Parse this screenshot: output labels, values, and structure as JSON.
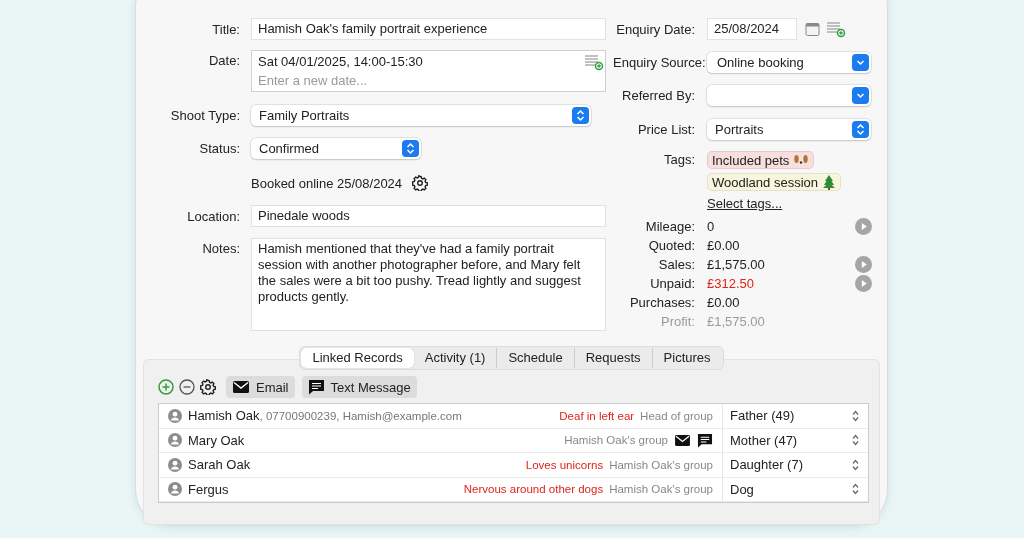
{
  "title": {
    "label": "Title:",
    "value": "Hamish Oak's family portrait experience"
  },
  "date": {
    "label": "Date:",
    "value": "Sat 04/01/2025, 14:00-15:30",
    "placeholder": "Enter a new date..."
  },
  "shoot_type": {
    "label": "Shoot Type:",
    "value": "Family Portraits"
  },
  "status": {
    "label": "Status:",
    "value": "Confirmed",
    "note": "Booked online 25/08/2024"
  },
  "location": {
    "label": "Location:",
    "value": "Pinedale woods"
  },
  "notes": {
    "label": "Notes:",
    "value": "Hamish mentioned that they've had a family portrait session with another photographer before, and Mary felt the sales were a bit too pushy. Tread lightly and suggest products gently."
  },
  "enquiry_date": {
    "label": "Enquiry Date:",
    "value": "25/08/2024"
  },
  "enquiry_source": {
    "label": "Enquiry Source:",
    "value": "Online booking"
  },
  "referred_by": {
    "label": "Referred By:"
  },
  "price_list": {
    "label": "Price List:",
    "value": "Portraits"
  },
  "tags": {
    "label": "Tags:",
    "link": "Select tags...",
    "items": [
      {
        "text": "Included pets",
        "color": "#f9dede",
        "kind": "dog"
      },
      {
        "text": "Woodland session",
        "color": "#f7f5dc",
        "kind": "tree"
      }
    ]
  },
  "financials": [
    {
      "label": "Mileage:",
      "value": "0",
      "kind": "normal",
      "has_button": true
    },
    {
      "label": "Quoted:",
      "value": "£0.00",
      "kind": "normal",
      "has_button": false
    },
    {
      "label": "Sales:",
      "value": "£1,575.00",
      "kind": "normal",
      "has_button": true
    },
    {
      "label": "Unpaid:",
      "value": "£312.50",
      "kind": "alert",
      "has_button": true
    },
    {
      "label": "Purchases:",
      "value": "£0.00",
      "kind": "normal",
      "has_button": false
    },
    {
      "label": "Profit:",
      "value": "£1,575.00",
      "kind": "muted",
      "has_button": false
    }
  ],
  "tabs": [
    {
      "label": "Linked Records",
      "selected": true
    },
    {
      "label": "Activity (1)",
      "selected": false
    },
    {
      "label": "Schedule",
      "selected": false
    },
    {
      "label": "Requests",
      "selected": false
    },
    {
      "label": "Pictures",
      "selected": false
    }
  ],
  "toolbar": {
    "buttons": [
      {
        "label": "Email",
        "kind": "email"
      },
      {
        "label": "Text Message",
        "kind": "message"
      }
    ]
  },
  "records": [
    {
      "name": "Hamish Oak",
      "details": ", 07700900239, Hamish@example.com",
      "note": "Deaf in left ear",
      "group": "Head of group",
      "relation": "Father (49)",
      "contact_icons": false
    },
    {
      "name": "Mary Oak",
      "group": "Hamish Oak's group",
      "relation": "Mother (47)",
      "contact_icons": true
    },
    {
      "name": "Sarah Oak",
      "note": "Loves unicorns",
      "group": "Hamish Oak's group",
      "relation": "Daughter (7)",
      "contact_icons": false
    },
    {
      "name": "Fergus",
      "note": "Nervous around other dogs",
      "group": "Hamish Oak's group",
      "relation": "Dog",
      "contact_icons": false
    }
  ]
}
